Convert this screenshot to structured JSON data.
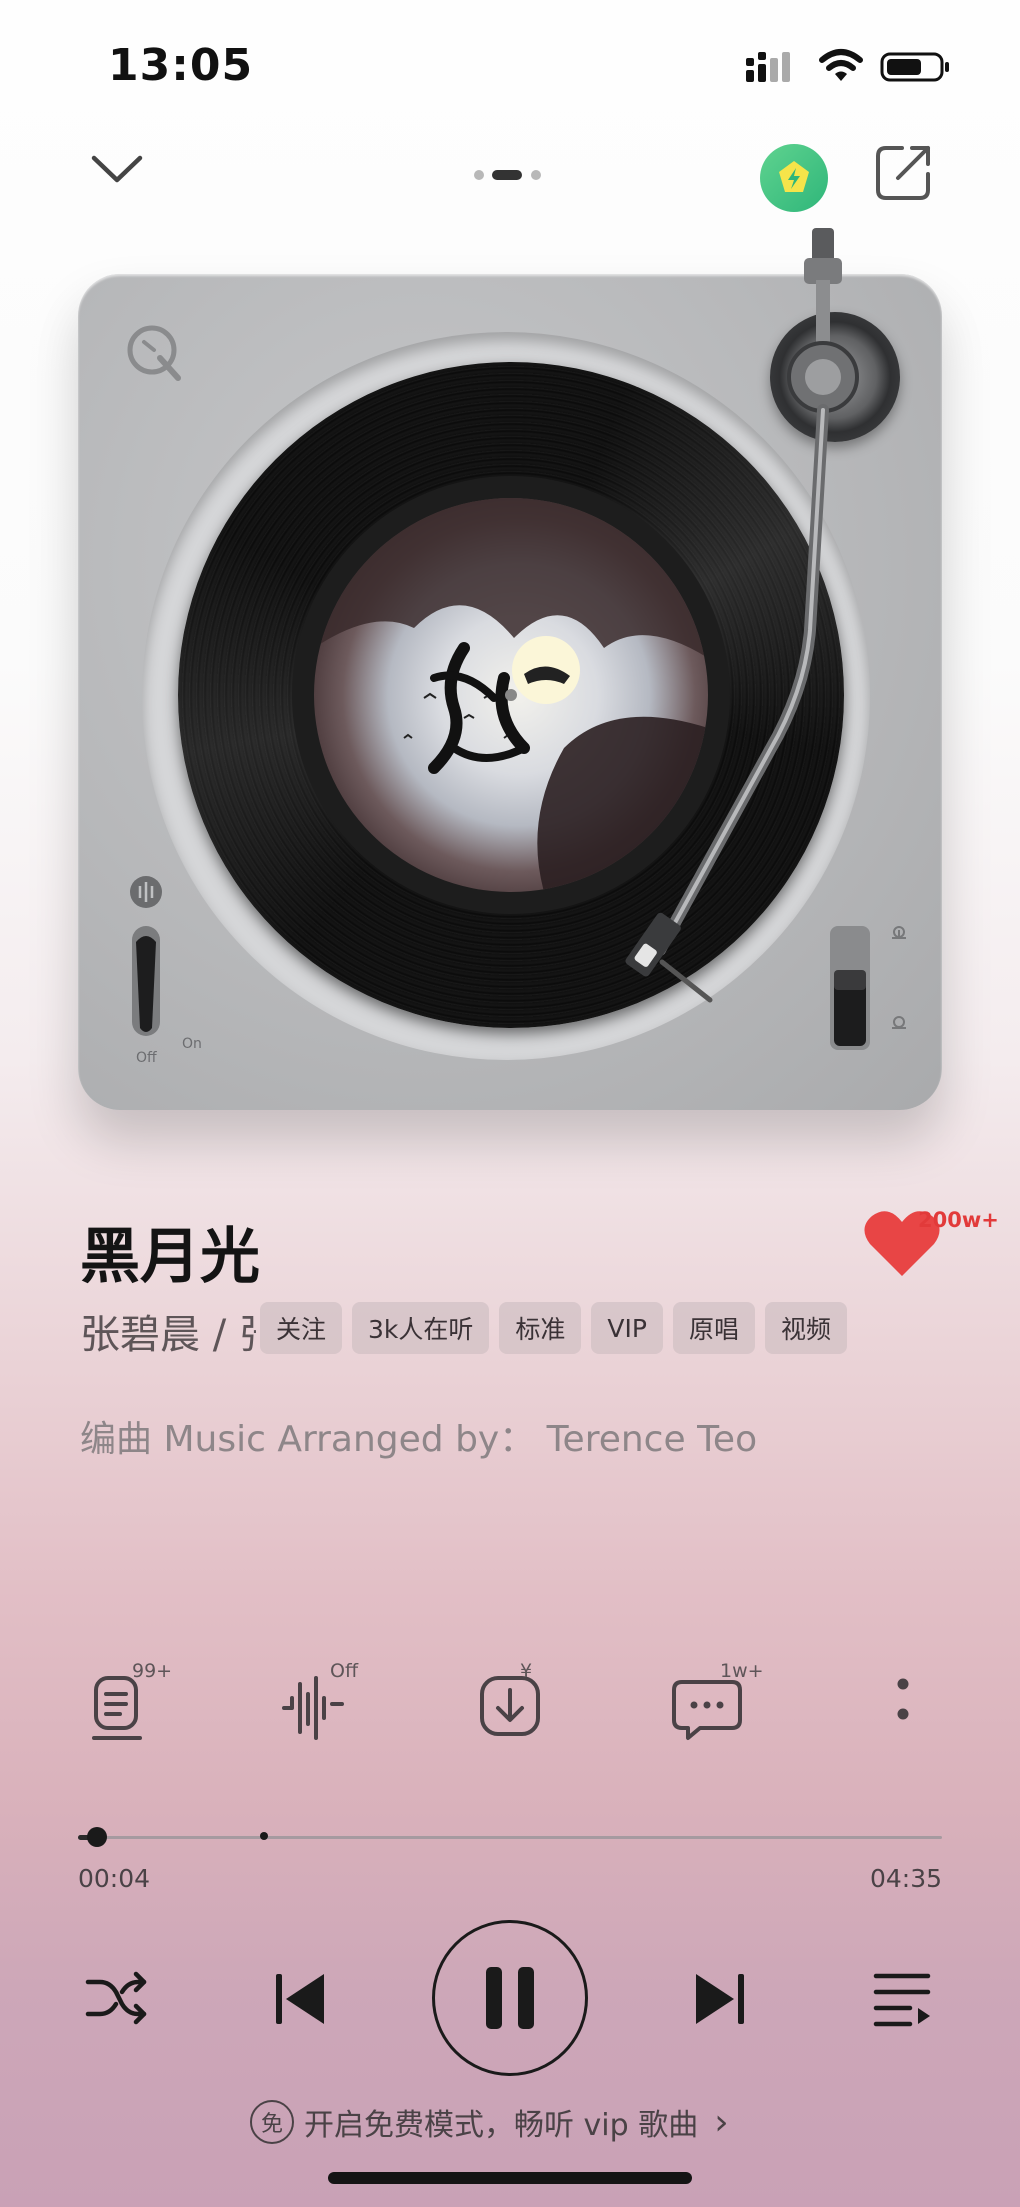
{
  "status_bar": {
    "time": "13:05"
  },
  "song": {
    "title": "黑月光",
    "artist": "张碧晨 / 张",
    "like_count": "200w+",
    "arranger_line": "编曲 Music Arranged by： Terence Teo",
    "tags": [
      "关注",
      "3k人在听",
      "标准",
      "VIP",
      "原唱",
      "视频"
    ]
  },
  "turntable": {
    "switch_off": "Off",
    "switch_on": "On"
  },
  "actions": {
    "lyrics_badge": "99+",
    "effect_badge": "Off",
    "download_badge": "¥",
    "comment_badge": "1w+"
  },
  "progress": {
    "current": "00:04",
    "total": "04:35",
    "fraction": 0.015,
    "buffer_fraction": 0.215
  },
  "promo": {
    "icon_text": "免",
    "text": "开启免费模式，畅听 vip 歌曲",
    "arrow": "›"
  },
  "colors": {
    "like": "#e84545",
    "vip_badge": "#3cc27f"
  }
}
